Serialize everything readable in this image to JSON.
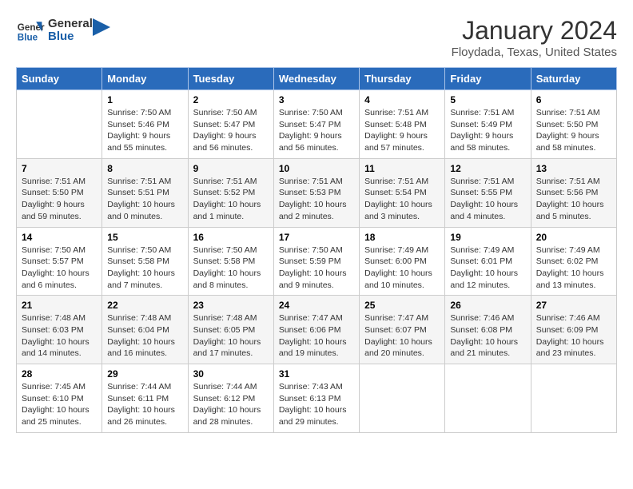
{
  "header": {
    "logo_line1": "General",
    "logo_line2": "Blue",
    "title": "January 2024",
    "subtitle": "Floydada, Texas, United States"
  },
  "days_of_week": [
    "Sunday",
    "Monday",
    "Tuesday",
    "Wednesday",
    "Thursday",
    "Friday",
    "Saturday"
  ],
  "weeks": [
    [
      {
        "day": "",
        "info": ""
      },
      {
        "day": "1",
        "info": "Sunrise: 7:50 AM\nSunset: 5:46 PM\nDaylight: 9 hours\nand 55 minutes."
      },
      {
        "day": "2",
        "info": "Sunrise: 7:50 AM\nSunset: 5:47 PM\nDaylight: 9 hours\nand 56 minutes."
      },
      {
        "day": "3",
        "info": "Sunrise: 7:50 AM\nSunset: 5:47 PM\nDaylight: 9 hours\nand 56 minutes."
      },
      {
        "day": "4",
        "info": "Sunrise: 7:51 AM\nSunset: 5:48 PM\nDaylight: 9 hours\nand 57 minutes."
      },
      {
        "day": "5",
        "info": "Sunrise: 7:51 AM\nSunset: 5:49 PM\nDaylight: 9 hours\nand 58 minutes."
      },
      {
        "day": "6",
        "info": "Sunrise: 7:51 AM\nSunset: 5:50 PM\nDaylight: 9 hours\nand 58 minutes."
      }
    ],
    [
      {
        "day": "7",
        "info": "Sunrise: 7:51 AM\nSunset: 5:50 PM\nDaylight: 9 hours\nand 59 minutes."
      },
      {
        "day": "8",
        "info": "Sunrise: 7:51 AM\nSunset: 5:51 PM\nDaylight: 10 hours\nand 0 minutes."
      },
      {
        "day": "9",
        "info": "Sunrise: 7:51 AM\nSunset: 5:52 PM\nDaylight: 10 hours\nand 1 minute."
      },
      {
        "day": "10",
        "info": "Sunrise: 7:51 AM\nSunset: 5:53 PM\nDaylight: 10 hours\nand 2 minutes."
      },
      {
        "day": "11",
        "info": "Sunrise: 7:51 AM\nSunset: 5:54 PM\nDaylight: 10 hours\nand 3 minutes."
      },
      {
        "day": "12",
        "info": "Sunrise: 7:51 AM\nSunset: 5:55 PM\nDaylight: 10 hours\nand 4 minutes."
      },
      {
        "day": "13",
        "info": "Sunrise: 7:51 AM\nSunset: 5:56 PM\nDaylight: 10 hours\nand 5 minutes."
      }
    ],
    [
      {
        "day": "14",
        "info": "Sunrise: 7:50 AM\nSunset: 5:57 PM\nDaylight: 10 hours\nand 6 minutes."
      },
      {
        "day": "15",
        "info": "Sunrise: 7:50 AM\nSunset: 5:58 PM\nDaylight: 10 hours\nand 7 minutes."
      },
      {
        "day": "16",
        "info": "Sunrise: 7:50 AM\nSunset: 5:58 PM\nDaylight: 10 hours\nand 8 minutes."
      },
      {
        "day": "17",
        "info": "Sunrise: 7:50 AM\nSunset: 5:59 PM\nDaylight: 10 hours\nand 9 minutes."
      },
      {
        "day": "18",
        "info": "Sunrise: 7:49 AM\nSunset: 6:00 PM\nDaylight: 10 hours\nand 10 minutes."
      },
      {
        "day": "19",
        "info": "Sunrise: 7:49 AM\nSunset: 6:01 PM\nDaylight: 10 hours\nand 12 minutes."
      },
      {
        "day": "20",
        "info": "Sunrise: 7:49 AM\nSunset: 6:02 PM\nDaylight: 10 hours\nand 13 minutes."
      }
    ],
    [
      {
        "day": "21",
        "info": "Sunrise: 7:48 AM\nSunset: 6:03 PM\nDaylight: 10 hours\nand 14 minutes."
      },
      {
        "day": "22",
        "info": "Sunrise: 7:48 AM\nSunset: 6:04 PM\nDaylight: 10 hours\nand 16 minutes."
      },
      {
        "day": "23",
        "info": "Sunrise: 7:48 AM\nSunset: 6:05 PM\nDaylight: 10 hours\nand 17 minutes."
      },
      {
        "day": "24",
        "info": "Sunrise: 7:47 AM\nSunset: 6:06 PM\nDaylight: 10 hours\nand 19 minutes."
      },
      {
        "day": "25",
        "info": "Sunrise: 7:47 AM\nSunset: 6:07 PM\nDaylight: 10 hours\nand 20 minutes."
      },
      {
        "day": "26",
        "info": "Sunrise: 7:46 AM\nSunset: 6:08 PM\nDaylight: 10 hours\nand 21 minutes."
      },
      {
        "day": "27",
        "info": "Sunrise: 7:46 AM\nSunset: 6:09 PM\nDaylight: 10 hours\nand 23 minutes."
      }
    ],
    [
      {
        "day": "28",
        "info": "Sunrise: 7:45 AM\nSunset: 6:10 PM\nDaylight: 10 hours\nand 25 minutes."
      },
      {
        "day": "29",
        "info": "Sunrise: 7:44 AM\nSunset: 6:11 PM\nDaylight: 10 hours\nand 26 minutes."
      },
      {
        "day": "30",
        "info": "Sunrise: 7:44 AM\nSunset: 6:12 PM\nDaylight: 10 hours\nand 28 minutes."
      },
      {
        "day": "31",
        "info": "Sunrise: 7:43 AM\nSunset: 6:13 PM\nDaylight: 10 hours\nand 29 minutes."
      },
      {
        "day": "",
        "info": ""
      },
      {
        "day": "",
        "info": ""
      },
      {
        "day": "",
        "info": ""
      }
    ]
  ]
}
